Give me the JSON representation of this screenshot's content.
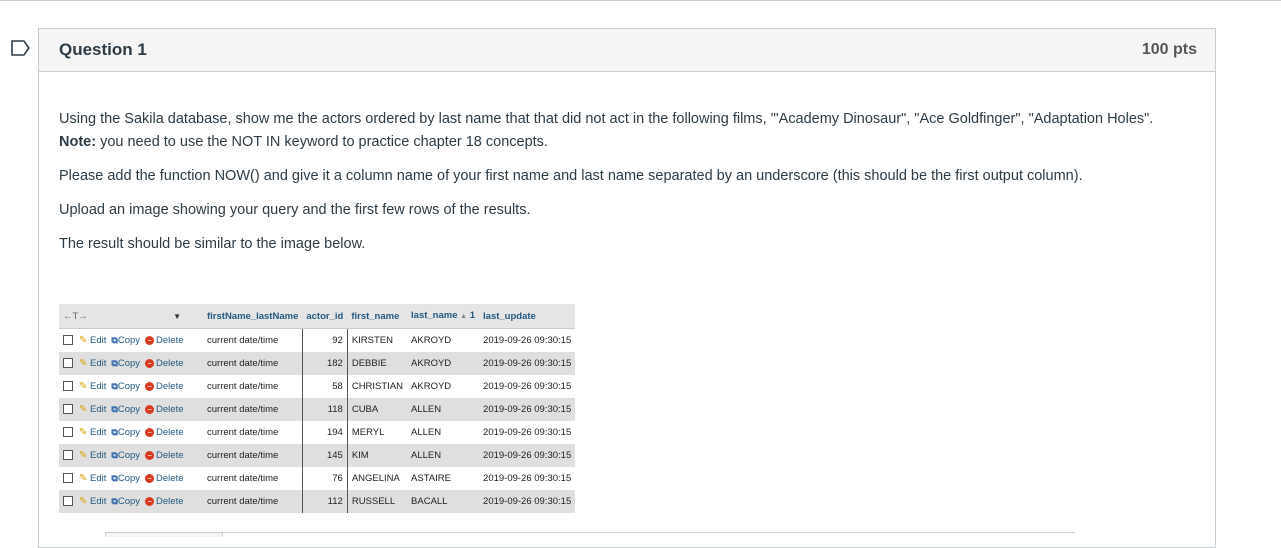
{
  "question": {
    "title": "Question 1",
    "points": "100 pts",
    "para1_main": "Using the Sakila database, show me the actors ordered by last name that that did not act in the following films, \"'Academy Dinosaur\", \"Ace Goldfinger\", \"Adaptation Holes\".",
    "note_label": "Note:",
    "note_text": " you need to use the NOT IN keyword to practice chapter 18 concepts.",
    "para2": "Please add the function NOW() and give it a column name of your first name and last name separated by an underscore (this should be the first output column).",
    "para3": "Upload an image showing your query and the first few rows of the results.",
    "para4": "The result should be similar to the image below."
  },
  "result_table": {
    "header_arrows": "←T→",
    "columns": {
      "c1": "firstName_lastName",
      "c2": "actor_id",
      "c3": "first_name",
      "c4": "last_name",
      "c4_sort": "1",
      "c5": "last_update"
    },
    "actions": {
      "edit": "Edit",
      "copy": "Copy",
      "delete": "Delete"
    },
    "rows": [
      {
        "c1": "current date/time",
        "actor_id": "92",
        "first_name": "KIRSTEN",
        "last_name": "AKROYD",
        "last_update": "2019-09-26 09:30:15"
      },
      {
        "c1": "current date/time",
        "actor_id": "182",
        "first_name": "DEBBIE",
        "last_name": "AKROYD",
        "last_update": "2019-09-26 09:30:15"
      },
      {
        "c1": "current date/time",
        "actor_id": "58",
        "first_name": "CHRISTIAN",
        "last_name": "AKROYD",
        "last_update": "2019-09-26 09:30:15"
      },
      {
        "c1": "current date/time",
        "actor_id": "118",
        "first_name": "CUBA",
        "last_name": "ALLEN",
        "last_update": "2019-09-26 09:30:15"
      },
      {
        "c1": "current date/time",
        "actor_id": "194",
        "first_name": "MERYL",
        "last_name": "ALLEN",
        "last_update": "2019-09-26 09:30:15"
      },
      {
        "c1": "current date/time",
        "actor_id": "145",
        "first_name": "KIM",
        "last_name": "ALLEN",
        "last_update": "2019-09-26 09:30:15"
      },
      {
        "c1": "current date/time",
        "actor_id": "76",
        "first_name": "ANGELINA",
        "last_name": "ASTAIRE",
        "last_update": "2019-09-26 09:30:15"
      },
      {
        "c1": "current date/time",
        "actor_id": "112",
        "first_name": "RUSSELL",
        "last_name": "BACALL",
        "last_update": "2019-09-26 09:30:15"
      }
    ]
  }
}
